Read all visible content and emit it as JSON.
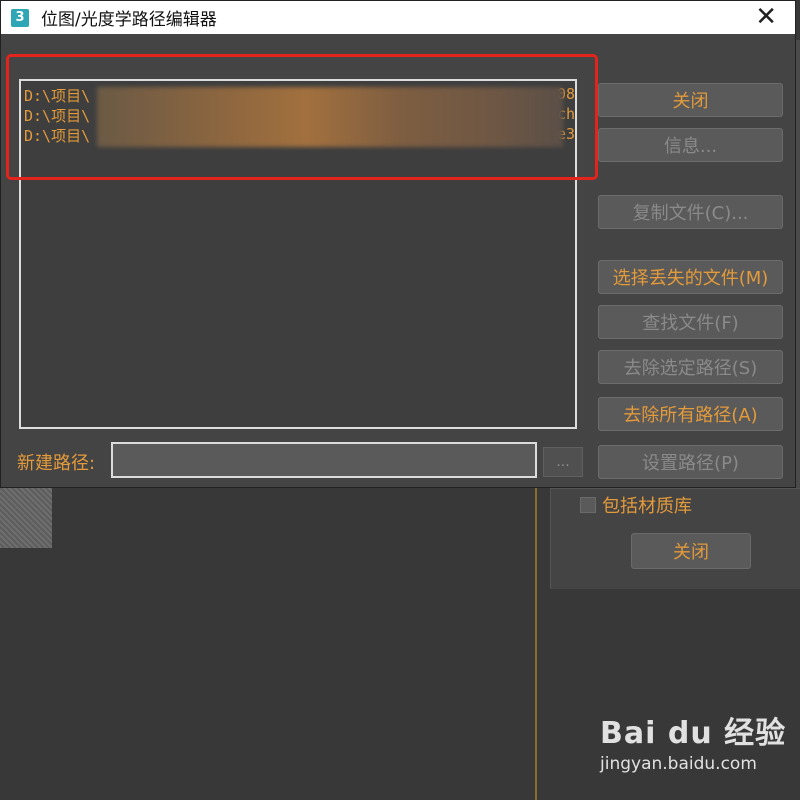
{
  "window": {
    "icon_label": "3",
    "title": "位图/光度学路径编辑器",
    "close_glyph": "✕"
  },
  "path_list": {
    "rows": [
      {
        "prefix": "D:\\项目\\",
        "tail": "08"
      },
      {
        "prefix": "D:\\项目\\",
        "tail": "ch"
      },
      {
        "prefix": "D:\\项目\\",
        "tail": "e3"
      }
    ]
  },
  "buttons": {
    "close": "关闭",
    "info": "信息...",
    "copy_files": "复制文件(C)...",
    "select_missing": "选择丢失的文件(M)",
    "find_files": "查找文件(F)",
    "strip_selected": "去除选定路径(S)",
    "strip_all": "去除所有路径(A)",
    "set_path": "设置路径(P)",
    "browse": "..."
  },
  "new_path": {
    "label": "新建路径:",
    "value": ""
  },
  "background": {
    "include_material_library": "包括材质库",
    "close": "关闭"
  },
  "watermark": {
    "logo": "Bai du 经验",
    "url": "jingyan.baidu.com"
  },
  "colors": {
    "accent_orange": "#e39a3a",
    "highlight_red": "#e3241c",
    "panel_gray": "#444444"
  }
}
